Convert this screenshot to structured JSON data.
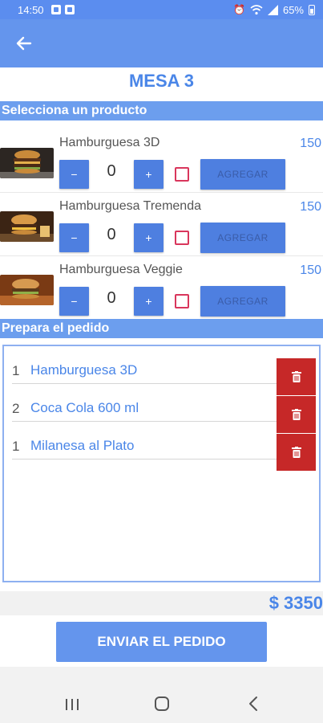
{
  "status_bar": {
    "time": "14:50",
    "battery": "65%"
  },
  "mesa_title": "MESA 3",
  "sections": {
    "select_product": "Selecciona un producto",
    "prepare_order": "Prepara el pedido"
  },
  "products": [
    {
      "name": "Hamburguesa 3D",
      "price": "150",
      "qty": "0",
      "add_label": "AGREGAR",
      "minus": "−",
      "plus": "+"
    },
    {
      "name": "Hamburguesa Tremenda",
      "price": "150",
      "qty": "0",
      "add_label": "AGREGAR",
      "minus": "−",
      "plus": "+"
    },
    {
      "name": "Hamburguesa Veggie",
      "price": "150",
      "qty": "0",
      "add_label": "AGREGAR",
      "minus": "−",
      "plus": "+"
    }
  ],
  "order_items": [
    {
      "qty": "1",
      "name": "Hamburguesa 3D"
    },
    {
      "qty": "2",
      "name": "Coca Cola 600 ml"
    },
    {
      "qty": "1",
      "name": "Milanesa al Plato"
    }
  ],
  "total": "$ 3350",
  "send_label": "ENVIAR EL PEDIDO",
  "colors": {
    "primary": "#6495ed",
    "accent_text": "#4a86e8",
    "delete": "#c62828",
    "checkbox": "#d9365c"
  },
  "icons": {
    "back": "arrow-left-icon",
    "delete": "trash-icon",
    "nav_recents": "recents-icon",
    "nav_home": "home-icon",
    "nav_back": "chevron-left-icon"
  }
}
